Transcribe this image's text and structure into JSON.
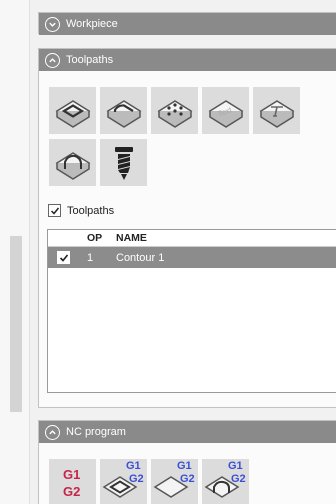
{
  "workpiece": {
    "title": "Workpiece"
  },
  "toolpaths": {
    "title": "Toolpaths",
    "tools": [
      {
        "name": "pocket-tool-icon"
      },
      {
        "name": "corner-pocket-tool-icon"
      },
      {
        "name": "drill-pattern-tool-icon"
      },
      {
        "name": "text-engrave-tool-icon",
        "text": "Text"
      },
      {
        "name": "text-cut-tool-icon"
      },
      {
        "name": "profile-arch-tool-icon"
      },
      {
        "name": "thread-mill-tool-icon"
      }
    ],
    "checkbox_label": "Toolpaths",
    "table": {
      "headers": {
        "op": "OP",
        "name": "NAME"
      },
      "rows": [
        {
          "op": "1",
          "name": "Contour 1",
          "checked": true
        }
      ]
    }
  },
  "nc_program": {
    "title": "NC program",
    "gcode_top": "G1",
    "gcode_bottom": "G2"
  },
  "colors": {
    "header": "#8a8a8a",
    "gcode_red": "#c8244a",
    "gcode_blue": "#3a4fd6"
  }
}
